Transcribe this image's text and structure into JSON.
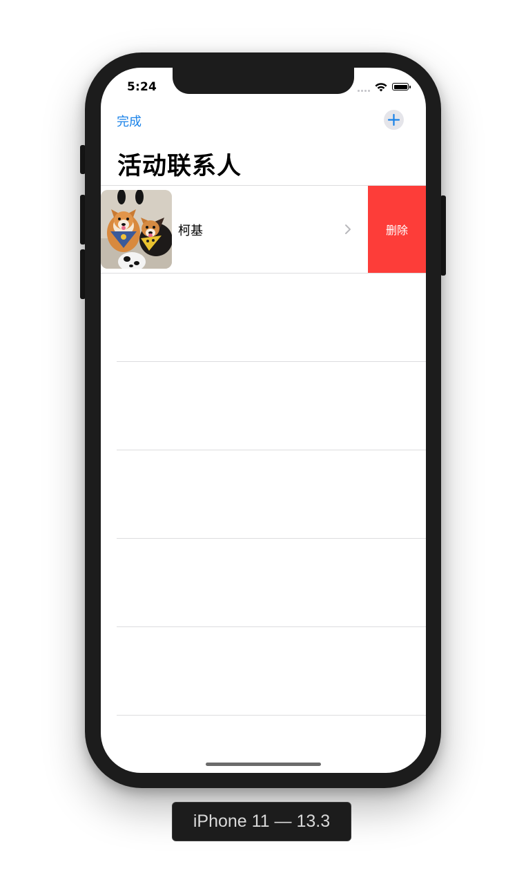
{
  "status_bar": {
    "time": "5:24"
  },
  "nav": {
    "done_label": "完成",
    "add_icon": "plus-icon",
    "title": "活动联系人"
  },
  "contacts": [
    {
      "name": "柯基",
      "delete_label": "删除",
      "chevron_icon": "chevron-right-icon",
      "avatar_icon": "corgi-photo"
    }
  ],
  "device_label": "iPhone 11 — 13.3",
  "colors": {
    "accent": "#1a82e8",
    "destructive": "#fd3d39",
    "separator": "#dcdcde",
    "frame": "#1c1c1c"
  }
}
